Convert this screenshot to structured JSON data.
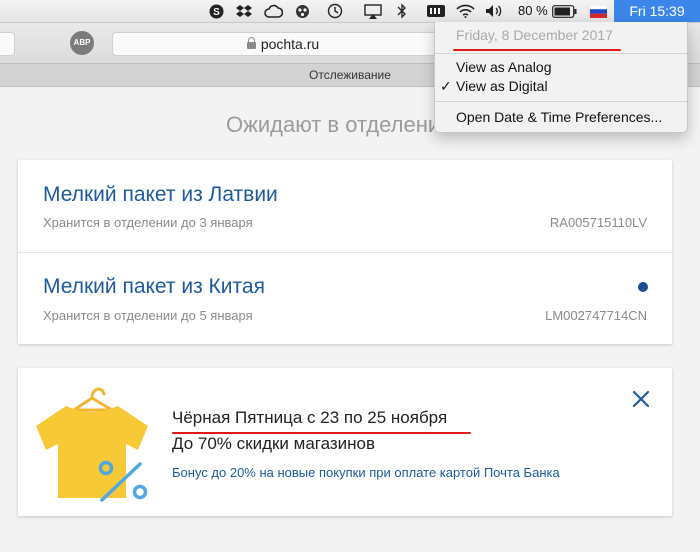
{
  "menubar": {
    "icons": [
      "skype-icon",
      "dropbox-icon",
      "creative-cloud-icon",
      "app-icon",
      "time-machine-icon",
      "airplay-icon",
      "bluetooth-icon",
      "battery-monitor-icon",
      "wifi-icon",
      "volume-icon",
      "battery-icon",
      "flag-icon"
    ],
    "battery_percent": "80 %",
    "clock": "Fri 15:39"
  },
  "browser": {
    "adblock_label": "ABP",
    "url": "pochta.ru",
    "tab_title": "Отслеживание"
  },
  "main": {
    "section_title": "Ожидают в отделении",
    "parcels": [
      {
        "title": "Мелкий пакет из Латвии",
        "status": "Хранится в отделении до 3 января",
        "code": "RA005715110LV",
        "unread": false
      },
      {
        "title": "Мелкий пакет из Китая",
        "status": "Хранится в отделении до 5 января",
        "code": "LM002747714CN",
        "unread": true
      }
    ],
    "promo": {
      "line1": "Чёрная Пятница с 23 по 25 ноября",
      "line2": "До 70% скидки магазинов",
      "line3": "Бонус до 20% на новые покупки при оплате картой Почта Банка"
    }
  },
  "clock_menu": {
    "date": "Friday, 8 December 2017",
    "items": [
      {
        "label": "View as Analog",
        "checked": false
      },
      {
        "label": "View as Digital",
        "checked": true
      }
    ],
    "preferences": "Open Date & Time Preferences..."
  },
  "colors": {
    "accent": "#3b86e8",
    "link_blue": "#1e5a9b",
    "annotation_red": "#e01a1a",
    "shirt_yellow": "#f7c936",
    "percent_blue": "#4fa8df"
  }
}
